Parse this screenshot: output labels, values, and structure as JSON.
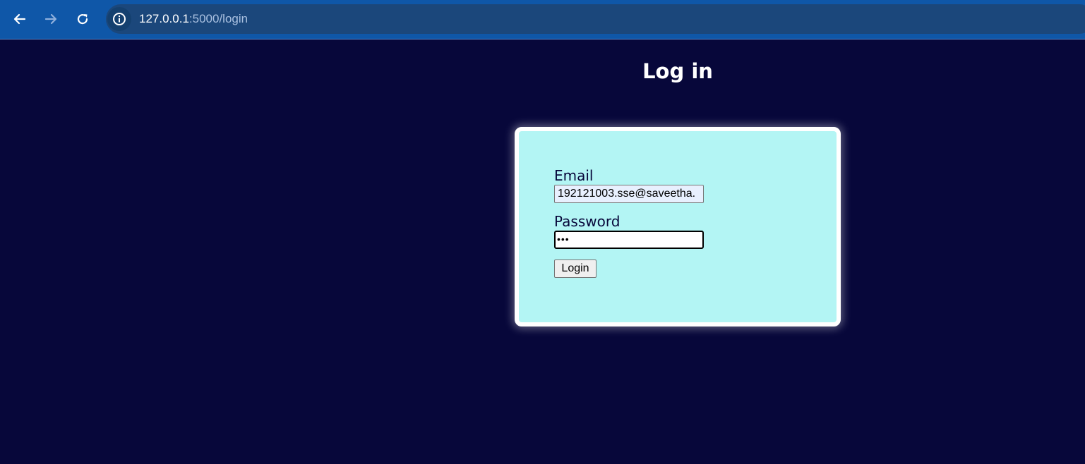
{
  "browser": {
    "url_host": "127.0.0.1",
    "url_rest": ":5000/login",
    "back_icon": "arrow-left-icon",
    "forward_icon": "arrow-right-icon",
    "reload_icon": "reload-icon",
    "info_icon": "info-icon"
  },
  "page": {
    "title": "Log in",
    "background_color": "#07073a",
    "card_color": "#b3f5f4"
  },
  "form": {
    "email_label": "Email",
    "email_value": "192121003.sse@saveetha.",
    "password_label": "Password",
    "password_value": "•••",
    "submit_label": "Login"
  }
}
